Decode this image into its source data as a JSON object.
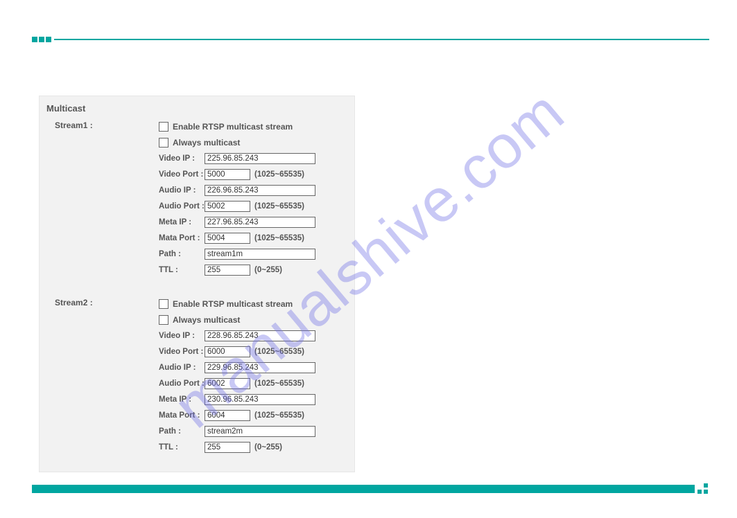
{
  "watermark": "manualshive.com",
  "panel": {
    "title": "Multicast"
  },
  "streams": [
    {
      "label": "Stream1 :",
      "enable_label": "Enable RTSP multicast stream",
      "always_label": "Always multicast",
      "videoip_label": "Video IP :",
      "videoip": "225.96.85.243",
      "videoport_label": "Video Port :",
      "videoport": "5000",
      "port_hint": "(1025~65535)",
      "audioip_label": "Audio IP :",
      "audioip": "226.96.85.243",
      "audioport_label": "Audio Port :",
      "audioport": "5002",
      "metaip_label": "Meta IP :",
      "metaip": "227.96.85.243",
      "mataport_label": "Mata Port :",
      "mataport": "5004",
      "path_label": "Path :",
      "path": "stream1m",
      "ttl_label": "TTL :",
      "ttl": "255",
      "ttl_hint": "(0~255)"
    },
    {
      "label": "Stream2 :",
      "enable_label": "Enable RTSP multicast stream",
      "always_label": "Always multicast",
      "videoip_label": "Video IP :",
      "videoip": "228.96.85.243",
      "videoport_label": "Video Port :",
      "videoport": "6000",
      "port_hint": "(1025~65535)",
      "audioip_label": "Audio IP :",
      "audioip": "229.96.85.243",
      "audioport_label": "Audio Port :",
      "audioport": "6002",
      "metaip_label": "Meta IP :",
      "metaip": "230.96.85.243",
      "mataport_label": "Mata Port :",
      "mataport": "6004",
      "path_label": "Path :",
      "path": "stream2m",
      "ttl_label": "TTL :",
      "ttl": "255",
      "ttl_hint": "(0~255)"
    }
  ]
}
